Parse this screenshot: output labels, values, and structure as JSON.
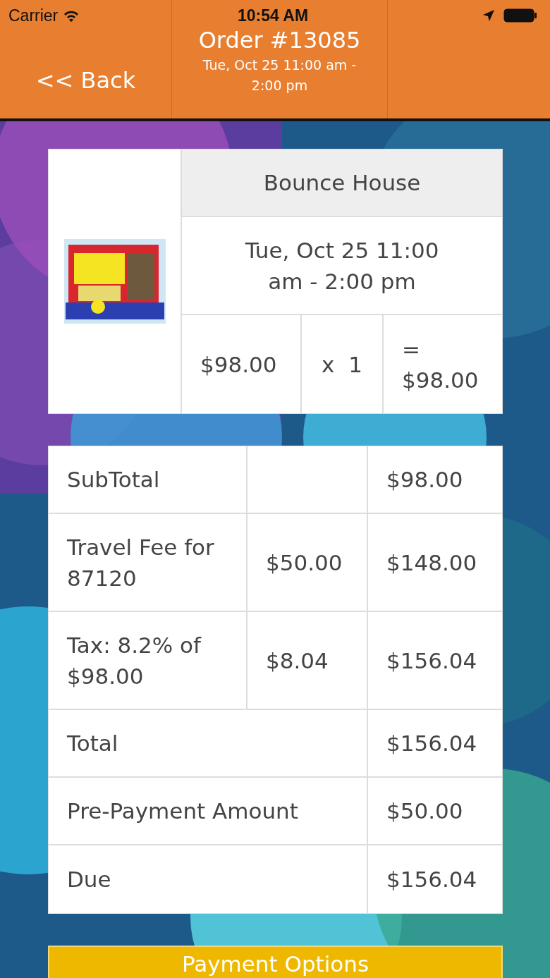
{
  "status_bar": {
    "carrier": "Carrier",
    "time": "10:54 AM"
  },
  "header": {
    "back": "<< Back",
    "title": "Order #13085",
    "subtitle": "Tue, Oct 25 11:00 am - 2:00 pm"
  },
  "item": {
    "name": "Bounce House",
    "date": "Tue, Oct 25 11:00 am - 2:00 pm",
    "price": "$98.00",
    "quantity": "x  1",
    "line_total": "= $98.00"
  },
  "summary": [
    {
      "kind": "three",
      "label": "SubTotal",
      "total": "$98.00"
    },
    {
      "kind": "three",
      "label": "Travel Fee for 87120",
      "amount": "$50.00",
      "total": "$148.00"
    },
    {
      "kind": "three",
      "label": "Tax: 8.2% of $98.00",
      "amount": "$8.04",
      "total": "$156.04"
    },
    {
      "kind": "two",
      "label": "Total",
      "total": "$156.04"
    },
    {
      "kind": "two",
      "label": "Pre-Payment Amount",
      "total": "$50.00"
    },
    {
      "kind": "two",
      "label": "Due",
      "total": "$156.04"
    }
  ],
  "payment_button": "Payment Options"
}
